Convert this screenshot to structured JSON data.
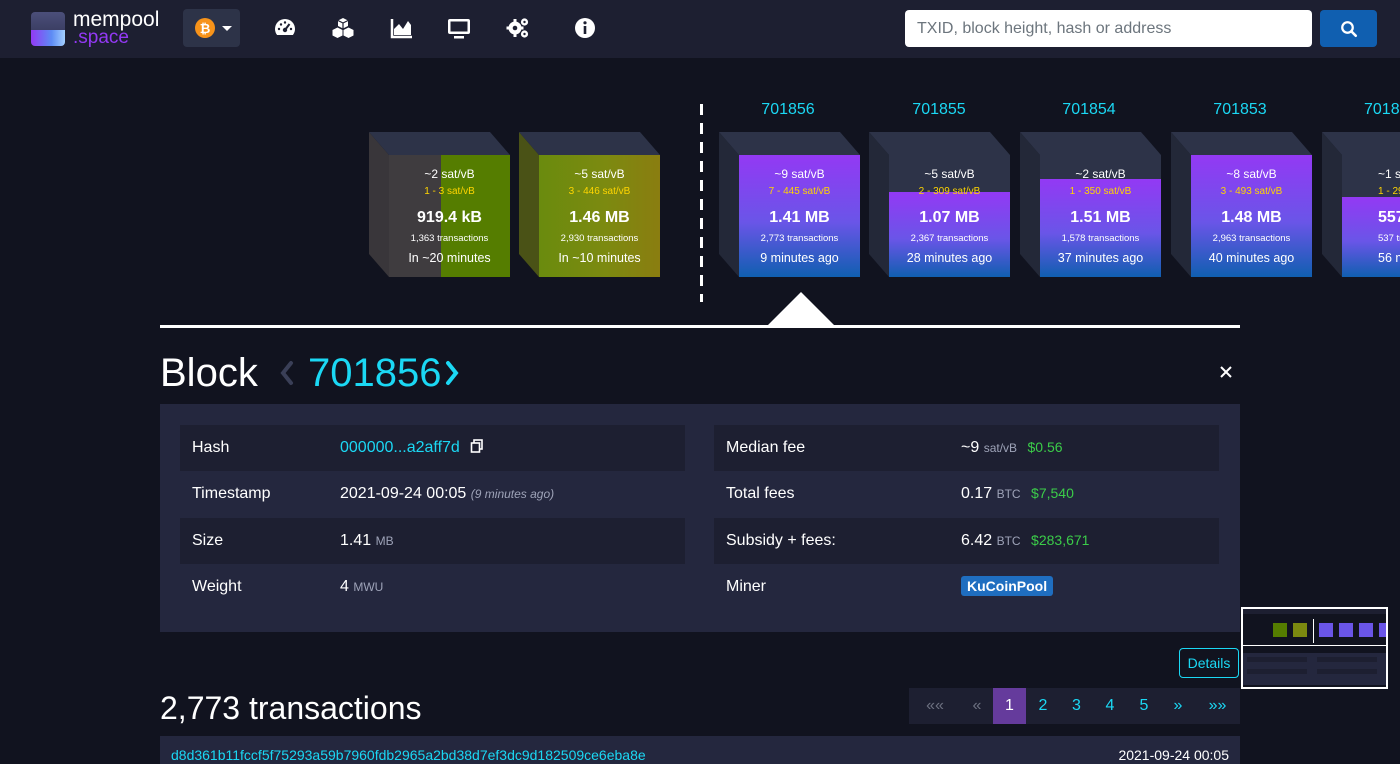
{
  "brand": {
    "name": "mempool",
    "sub": ".space"
  },
  "network": {
    "icon": "bitcoin-icon",
    "symbol": "₿"
  },
  "nav": [
    {
      "name": "dashboard-gauge-icon"
    },
    {
      "name": "mining-pools-icon"
    },
    {
      "name": "graphs-icon"
    },
    {
      "name": "tv-icon"
    },
    {
      "name": "settings-gears-icon"
    },
    {
      "name": "info-icon"
    }
  ],
  "search": {
    "placeholder": "TXID, block height, hash or address",
    "button_icon": "search-icon"
  },
  "mempool_blocks": [
    {
      "median_fee": "~2 sat/vB",
      "fee_range": "1 - 3 sat/vB",
      "size": "919.4 kB",
      "tx": "1,363 transactions",
      "eta": "In ~20 minutes",
      "fill": 0.62
    },
    {
      "median_fee": "~5 sat/vB",
      "fee_range": "3 - 446 sat/vB",
      "size": "1.46 MB",
      "tx": "2,930 transactions",
      "eta": "In ~10 minutes",
      "fill": 1.0
    }
  ],
  "blocks": [
    {
      "height": "701856",
      "median_fee": "~9 sat/vB",
      "fee_range": "7 - 445 sat/vB",
      "size": "1.41 MB",
      "tx": "2,773 transactions",
      "time": "9 minutes ago",
      "fill": 1.0
    },
    {
      "height": "701855",
      "median_fee": "~5 sat/vB",
      "fee_range": "2 - 309 sat/vB",
      "size": "1.07 MB",
      "tx": "2,367 transactions",
      "time": "28 minutes ago",
      "fill": 0.75
    },
    {
      "height": "701854",
      "median_fee": "~2 sat/vB",
      "fee_range": "1 - 350 sat/vB",
      "size": "1.51 MB",
      "tx": "1,578 transactions",
      "time": "37 minutes ago",
      "fill": 0.82
    },
    {
      "height": "701853",
      "median_fee": "~8 sat/vB",
      "fee_range": "3 - 493 sat/vB",
      "size": "1.48 MB",
      "tx": "2,963 transactions",
      "time": "40 minutes ago",
      "fill": 1.0
    },
    {
      "height": "7018",
      "median_fee": "~1 s",
      "fee_range": "1 - 29",
      "size": "557.",
      "tx": "537 tran",
      "time": "56 minu",
      "fill": 0.4
    }
  ],
  "block_header": {
    "title": "Block",
    "height": "701856"
  },
  "details_left": [
    {
      "label": "Hash",
      "value": "000000...a2aff7d",
      "copy_icon": "copy-icon"
    },
    {
      "label": "Timestamp",
      "value": "2021-09-24 00:05",
      "sub": "(9 minutes ago)"
    },
    {
      "label": "Size",
      "value": "1.41",
      "unit": "MB"
    },
    {
      "label": "Weight",
      "value": "4",
      "unit": "MWU"
    }
  ],
  "details_right": [
    {
      "label": "Median fee",
      "value": "~9",
      "unit": "sat/vB",
      "usd": "$0.56"
    },
    {
      "label": "Total fees",
      "value": "0.17",
      "unit": "BTC",
      "usd": "$7,540"
    },
    {
      "label": "Subsidy + fees:",
      "value": "6.42",
      "unit": "BTC",
      "usd": "$283,671"
    },
    {
      "label": "Miner",
      "badge": "KuCoinPool"
    }
  ],
  "details_button": "Details",
  "transactions": {
    "count_label": "2,773 transactions",
    "pagination": [
      "««",
      "«",
      "1",
      "2",
      "3",
      "4",
      "5",
      "»",
      "»»"
    ],
    "active_page": "1",
    "first_tx": {
      "txid": "d8d361b11fccf5f75293a59b7960fdb2965a2bd38d7ef3dc9d182509ce6eba8e",
      "time": "2021-09-24 00:05"
    }
  },
  "colors": {
    "background": "#11131f",
    "navbar": "#1d1f31",
    "accent_cyan": "#1bd8f4",
    "purple": "#9339f4",
    "blue": "#105fb0",
    "green_usd": "#3bcc49",
    "pager_active": "#653b9c"
  }
}
